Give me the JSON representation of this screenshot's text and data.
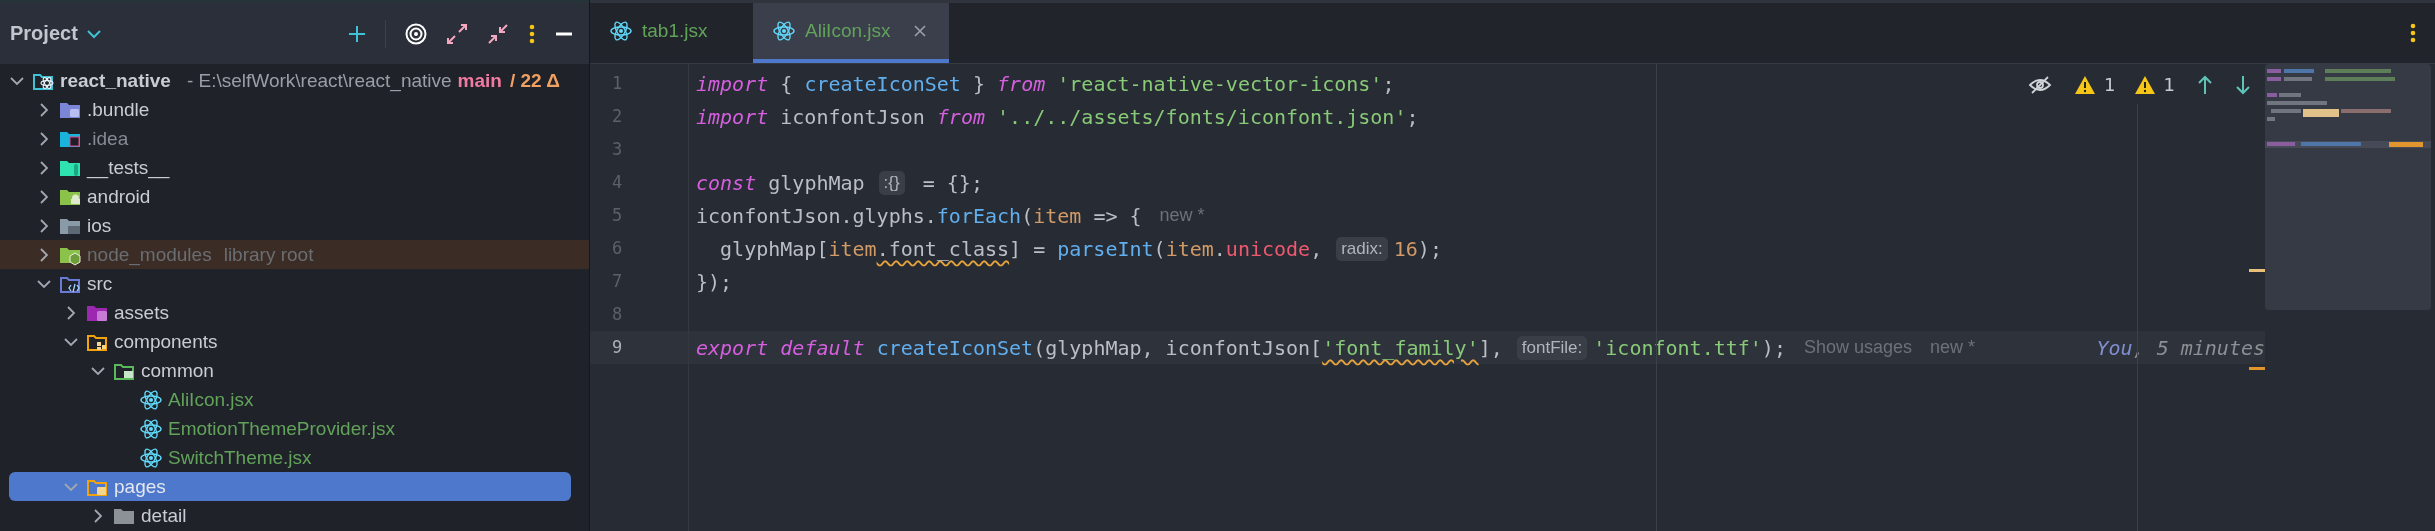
{
  "project_panel": {
    "title": "Project",
    "tree": [
      {
        "kind": "project",
        "label": "react_native",
        "path": "- E:\\selfWork\\react\\react_native",
        "branch": "main",
        "changes": "/ 22 Δ",
        "expanded": true,
        "selected": false,
        "color": "#c9ccd3",
        "children": [
          {
            "kind": "bundle",
            "label": ".bundle",
            "expanded": false,
            "selected": false,
            "color": "#c9ccd3"
          },
          {
            "kind": "idea",
            "label": ".idea",
            "expanded": false,
            "selected": false,
            "color": "#868a92"
          },
          {
            "kind": "tests",
            "label": "__tests__",
            "expanded": false,
            "selected": false,
            "color": "#c9ccd3"
          },
          {
            "kind": "android",
            "label": "android",
            "expanded": false,
            "selected": false,
            "color": "#c9ccd3"
          },
          {
            "kind": "ios",
            "label": "ios",
            "expanded": false,
            "selected": false,
            "color": "#c9ccd3"
          },
          {
            "kind": "node",
            "label": "node_modules",
            "note": "library root",
            "excluded": true,
            "expanded": false,
            "selected": false,
            "color": "#6a6d72"
          },
          {
            "kind": "src",
            "label": "src",
            "expanded": true,
            "selected": false,
            "color": "#c9ccd3",
            "children": [
              {
                "kind": "assets",
                "label": "assets",
                "expanded": false,
                "selected": false,
                "color": "#c9ccd3"
              },
              {
                "kind": "components",
                "label": "components",
                "expanded": true,
                "selected": false,
                "color": "#c9ccd3",
                "children": [
                  {
                    "kind": "common",
                    "label": "common",
                    "expanded": true,
                    "selected": false,
                    "color": "#c9ccd3",
                    "children": [
                      {
                        "kind": "file",
                        "label": "AliIcon.jsx",
                        "selected": false,
                        "color": "#62a35a"
                      },
                      {
                        "kind": "file",
                        "label": "EmotionThemeProvider.jsx",
                        "selected": false,
                        "color": "#62a35a"
                      },
                      {
                        "kind": "file",
                        "label": "SwitchTheme.jsx",
                        "selected": false,
                        "color": "#62a35a"
                      }
                    ]
                  }
                ]
              },
              {
                "kind": "pages",
                "label": "pages",
                "expanded": true,
                "selected": true,
                "color": "#e4e7ee",
                "children": [
                  {
                    "kind": "plain",
                    "label": "detail",
                    "expanded": false,
                    "selected": false,
                    "color": "#c9ccd3"
                  }
                ]
              }
            ]
          }
        ]
      }
    ]
  },
  "editor": {
    "tabs": [
      {
        "label": "tab1.jsx",
        "selected": false
      },
      {
        "label": "AliIcon.jsx",
        "selected": true
      }
    ],
    "inspections": {
      "warnings": "1",
      "weak_warnings": "1"
    },
    "lines": [
      {
        "number": "1",
        "current": false,
        "tokens": [
          {
            "kind": "keyword",
            "text": "import"
          },
          {
            "kind": "plain",
            "text": " { "
          },
          {
            "kind": "function",
            "text": "createIconSet"
          },
          {
            "kind": "plain",
            "text": " } "
          },
          {
            "kind": "keyword",
            "text": "from "
          },
          {
            "kind": "string",
            "text": "'react-native-vector-icons'"
          },
          {
            "kind": "plain",
            "text": ";"
          }
        ]
      },
      {
        "number": "2",
        "current": false,
        "tokens": [
          {
            "kind": "keyword",
            "text": "import"
          },
          {
            "kind": "plain",
            "text": " iconfontJson "
          },
          {
            "kind": "keyword",
            "text": "from "
          },
          {
            "kind": "string",
            "text": "'../../assets/fonts/iconfont.json'"
          },
          {
            "kind": "plain",
            "text": ";"
          }
        ]
      },
      {
        "number": "3",
        "current": false
      },
      {
        "number": "4",
        "current": false,
        "tokens": [
          {
            "kind": "keyword",
            "text": "const"
          },
          {
            "kind": "plain",
            "text": " glyphMap"
          },
          {
            "kind": "hint",
            "text": ":{}"
          },
          {
            "kind": "plain",
            "text": " = {};"
          }
        ]
      },
      {
        "number": "5",
        "current": false,
        "tokens": [
          {
            "kind": "plain",
            "text": "iconfontJson.glyphs."
          },
          {
            "kind": "function",
            "text": "forEach"
          },
          {
            "kind": "plain",
            "text": "("
          },
          {
            "kind": "param",
            "text": "item"
          },
          {
            "kind": "plain",
            "text": " => {"
          },
          {
            "kind": "ghost",
            "text": "new *"
          }
        ]
      },
      {
        "number": "6",
        "current": false,
        "tokens": [
          {
            "kind": "plain",
            "text": "  glyphMap["
          },
          {
            "kind": "param",
            "text": "item"
          },
          {
            "kind": "plain",
            "text": ".font_class",
            "warning": true
          },
          {
            "kind": "plain",
            "text": "] = "
          },
          {
            "kind": "function",
            "text": "parseInt"
          },
          {
            "kind": "plain",
            "text": "("
          },
          {
            "kind": "param",
            "text": "item"
          },
          {
            "kind": "plain",
            "text": "."
          },
          {
            "kind": "field",
            "text": "unicode"
          },
          {
            "kind": "plain",
            "text": ","
          },
          {
            "kind": "hint",
            "text": "radix:"
          },
          {
            "kind": "number",
            "text": "16"
          },
          {
            "kind": "plain",
            "text": ");"
          }
        ]
      },
      {
        "number": "7",
        "current": false,
        "tokens": [
          {
            "kind": "plain",
            "text": "});"
          }
        ]
      },
      {
        "number": "8",
        "current": false
      },
      {
        "number": "9",
        "current": true,
        "tokens": [
          {
            "kind": "keyword",
            "text": "export "
          },
          {
            "kind": "keyword",
            "text": "default "
          },
          {
            "kind": "function",
            "text": "createIconSet"
          },
          {
            "kind": "plain",
            "text": "(glyphMap, iconfontJson["
          },
          {
            "kind": "string",
            "text": "'font_family'",
            "warning": true
          },
          {
            "kind": "plain",
            "text": "],"
          },
          {
            "kind": "hint",
            "text": "fontFile:"
          },
          {
            "kind": "string",
            "text": "'iconfont.ttf'"
          },
          {
            "kind": "plain",
            "text": ");"
          },
          {
            "kind": "ghost",
            "text": "Show usages"
          },
          {
            "kind": "ghost",
            "text": "new *"
          }
        ],
        "blame": {
          "author": "You",
          "time": ", 5 minutes"
        }
      }
    ]
  }
}
